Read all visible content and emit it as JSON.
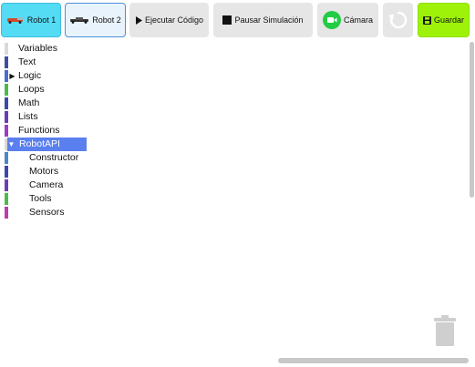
{
  "toolbar": {
    "robot1_label": "Robot 1",
    "robot2_label": "Robot 2",
    "run_label": "Ejecutar Código",
    "pause_label": "Pausar Simulación",
    "camera_label": "Cámara",
    "save_label": "Guardar"
  },
  "categories": [
    {
      "label": "Variables",
      "color": "#d9d9d9"
    },
    {
      "label": "Text",
      "color": "#3c4fa0"
    },
    {
      "label": "Logic",
      "color": "#4a6cd4"
    },
    {
      "label": "Loops",
      "color": "#4cbb4c"
    },
    {
      "label": "Math",
      "color": "#3a4aa8"
    },
    {
      "label": "Lists",
      "color": "#6a3db8"
    },
    {
      "label": "Functions",
      "color": "#9b3ec1"
    },
    {
      "label": "RobotAPI",
      "color": "#d9d9d9"
    }
  ],
  "subcategories": [
    {
      "label": "Constructor",
      "color": "#4a88c8"
    },
    {
      "label": "Motors",
      "color": "#3a4aa8"
    },
    {
      "label": "Camera",
      "color": "#6a3db8"
    },
    {
      "label": "Tools",
      "color": "#4cbb4c"
    },
    {
      "label": "Sensors",
      "color": "#c03ca8"
    }
  ],
  "icons": {
    "robot": "robot-car-icon",
    "run": "play-icon",
    "pause": "stop-square-icon",
    "camera": "video-camera-icon",
    "reset": "refresh-icon",
    "save": "floppy-disk-icon",
    "trash": "trash-can-icon"
  },
  "colors": {
    "robot1_active": "#55dcf5",
    "save_button": "#9ef20a",
    "selected_category": "#5a7fee",
    "camera_icon": "#22cc44"
  }
}
